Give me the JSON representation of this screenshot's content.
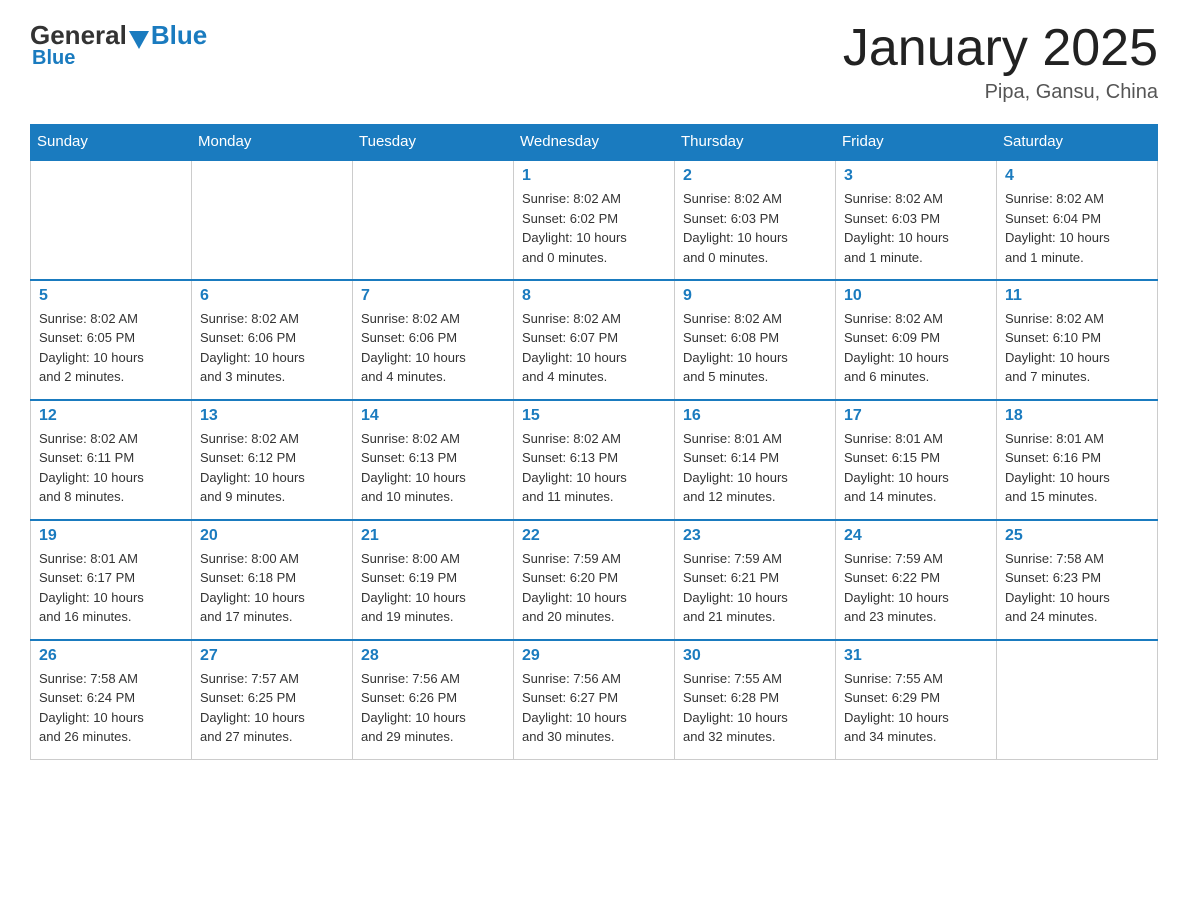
{
  "header": {
    "logo_general": "General",
    "logo_blue": "Blue",
    "month_title": "January 2025",
    "location": "Pipa, Gansu, China"
  },
  "days_of_week": [
    "Sunday",
    "Monday",
    "Tuesday",
    "Wednesday",
    "Thursday",
    "Friday",
    "Saturday"
  ],
  "weeks": [
    [
      {
        "day": "",
        "info": ""
      },
      {
        "day": "",
        "info": ""
      },
      {
        "day": "",
        "info": ""
      },
      {
        "day": "1",
        "info": "Sunrise: 8:02 AM\nSunset: 6:02 PM\nDaylight: 10 hours\nand 0 minutes."
      },
      {
        "day": "2",
        "info": "Sunrise: 8:02 AM\nSunset: 6:03 PM\nDaylight: 10 hours\nand 0 minutes."
      },
      {
        "day": "3",
        "info": "Sunrise: 8:02 AM\nSunset: 6:03 PM\nDaylight: 10 hours\nand 1 minute."
      },
      {
        "day": "4",
        "info": "Sunrise: 8:02 AM\nSunset: 6:04 PM\nDaylight: 10 hours\nand 1 minute."
      }
    ],
    [
      {
        "day": "5",
        "info": "Sunrise: 8:02 AM\nSunset: 6:05 PM\nDaylight: 10 hours\nand 2 minutes."
      },
      {
        "day": "6",
        "info": "Sunrise: 8:02 AM\nSunset: 6:06 PM\nDaylight: 10 hours\nand 3 minutes."
      },
      {
        "day": "7",
        "info": "Sunrise: 8:02 AM\nSunset: 6:06 PM\nDaylight: 10 hours\nand 4 minutes."
      },
      {
        "day": "8",
        "info": "Sunrise: 8:02 AM\nSunset: 6:07 PM\nDaylight: 10 hours\nand 4 minutes."
      },
      {
        "day": "9",
        "info": "Sunrise: 8:02 AM\nSunset: 6:08 PM\nDaylight: 10 hours\nand 5 minutes."
      },
      {
        "day": "10",
        "info": "Sunrise: 8:02 AM\nSunset: 6:09 PM\nDaylight: 10 hours\nand 6 minutes."
      },
      {
        "day": "11",
        "info": "Sunrise: 8:02 AM\nSunset: 6:10 PM\nDaylight: 10 hours\nand 7 minutes."
      }
    ],
    [
      {
        "day": "12",
        "info": "Sunrise: 8:02 AM\nSunset: 6:11 PM\nDaylight: 10 hours\nand 8 minutes."
      },
      {
        "day": "13",
        "info": "Sunrise: 8:02 AM\nSunset: 6:12 PM\nDaylight: 10 hours\nand 9 minutes."
      },
      {
        "day": "14",
        "info": "Sunrise: 8:02 AM\nSunset: 6:13 PM\nDaylight: 10 hours\nand 10 minutes."
      },
      {
        "day": "15",
        "info": "Sunrise: 8:02 AM\nSunset: 6:13 PM\nDaylight: 10 hours\nand 11 minutes."
      },
      {
        "day": "16",
        "info": "Sunrise: 8:01 AM\nSunset: 6:14 PM\nDaylight: 10 hours\nand 12 minutes."
      },
      {
        "day": "17",
        "info": "Sunrise: 8:01 AM\nSunset: 6:15 PM\nDaylight: 10 hours\nand 14 minutes."
      },
      {
        "day": "18",
        "info": "Sunrise: 8:01 AM\nSunset: 6:16 PM\nDaylight: 10 hours\nand 15 minutes."
      }
    ],
    [
      {
        "day": "19",
        "info": "Sunrise: 8:01 AM\nSunset: 6:17 PM\nDaylight: 10 hours\nand 16 minutes."
      },
      {
        "day": "20",
        "info": "Sunrise: 8:00 AM\nSunset: 6:18 PM\nDaylight: 10 hours\nand 17 minutes."
      },
      {
        "day": "21",
        "info": "Sunrise: 8:00 AM\nSunset: 6:19 PM\nDaylight: 10 hours\nand 19 minutes."
      },
      {
        "day": "22",
        "info": "Sunrise: 7:59 AM\nSunset: 6:20 PM\nDaylight: 10 hours\nand 20 minutes."
      },
      {
        "day": "23",
        "info": "Sunrise: 7:59 AM\nSunset: 6:21 PM\nDaylight: 10 hours\nand 21 minutes."
      },
      {
        "day": "24",
        "info": "Sunrise: 7:59 AM\nSunset: 6:22 PM\nDaylight: 10 hours\nand 23 minutes."
      },
      {
        "day": "25",
        "info": "Sunrise: 7:58 AM\nSunset: 6:23 PM\nDaylight: 10 hours\nand 24 minutes."
      }
    ],
    [
      {
        "day": "26",
        "info": "Sunrise: 7:58 AM\nSunset: 6:24 PM\nDaylight: 10 hours\nand 26 minutes."
      },
      {
        "day": "27",
        "info": "Sunrise: 7:57 AM\nSunset: 6:25 PM\nDaylight: 10 hours\nand 27 minutes."
      },
      {
        "day": "28",
        "info": "Sunrise: 7:56 AM\nSunset: 6:26 PM\nDaylight: 10 hours\nand 29 minutes."
      },
      {
        "day": "29",
        "info": "Sunrise: 7:56 AM\nSunset: 6:27 PM\nDaylight: 10 hours\nand 30 minutes."
      },
      {
        "day": "30",
        "info": "Sunrise: 7:55 AM\nSunset: 6:28 PM\nDaylight: 10 hours\nand 32 minutes."
      },
      {
        "day": "31",
        "info": "Sunrise: 7:55 AM\nSunset: 6:29 PM\nDaylight: 10 hours\nand 34 minutes."
      },
      {
        "day": "",
        "info": ""
      }
    ]
  ]
}
